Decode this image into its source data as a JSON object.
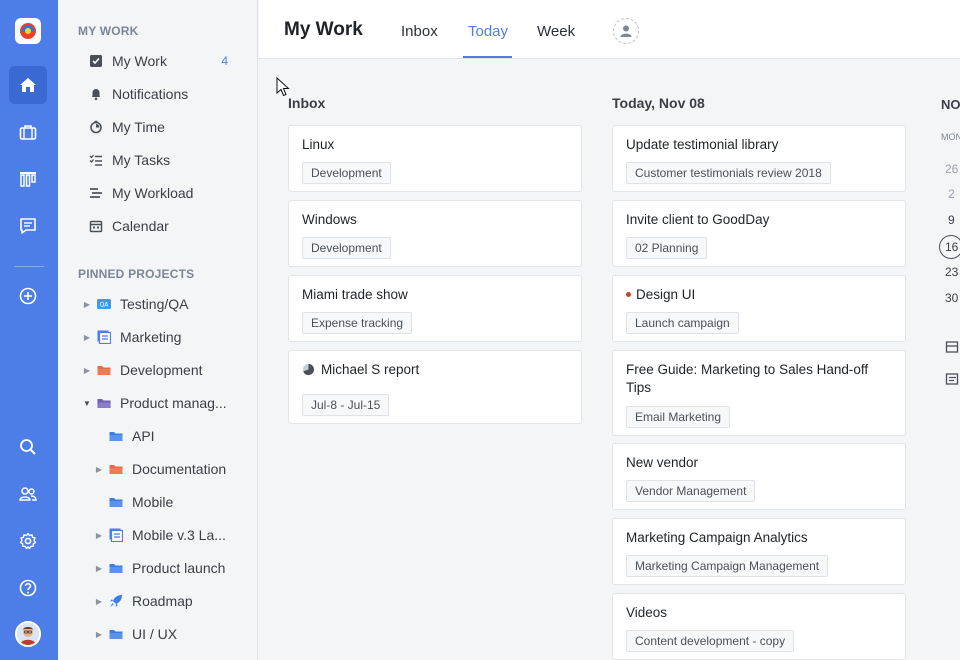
{
  "header": {
    "title": "My Work",
    "tabs": [
      {
        "label": "Inbox",
        "active": false
      },
      {
        "label": "Today",
        "active": true
      },
      {
        "label": "Week",
        "active": false
      }
    ]
  },
  "rail": {
    "icons": [
      "logo-icon",
      "home-icon",
      "briefcase-icon",
      "columns-icon",
      "chat-icon",
      "add-icon",
      "search-icon",
      "users-icon",
      "gear-icon",
      "help-icon",
      "user-avatar"
    ],
    "accent": "#4d7de6"
  },
  "sidebar": {
    "my_work_title": "MY WORK",
    "my_work_items": [
      {
        "label": "My Work",
        "icon": "check-square-icon",
        "count": "4"
      },
      {
        "label": "Notifications",
        "icon": "bell-icon"
      },
      {
        "label": "My Time",
        "icon": "timer-icon"
      },
      {
        "label": "My Tasks",
        "icon": "task-list-icon"
      },
      {
        "label": "My Workload",
        "icon": "workload-icon"
      },
      {
        "label": "Calendar",
        "icon": "calendar-icon"
      }
    ],
    "pinned_title": "PINNED PROJECTS",
    "pinned_items": [
      {
        "label": "Testing/QA",
        "icon": "qa-badge-icon",
        "badge": "QA",
        "caret": "right",
        "level": 0
      },
      {
        "label": "Marketing",
        "icon": "board-icon",
        "caret": "right",
        "level": 0
      },
      {
        "label": "Development",
        "icon": "folder-icon",
        "caret": "right",
        "level": 0
      },
      {
        "label": "Product manag...",
        "icon": "folder-icon",
        "caret": "down",
        "level": 0
      },
      {
        "label": "API",
        "icon": "folder-icon",
        "caret": "none",
        "level": 1
      },
      {
        "label": "Documentation",
        "icon": "folder-icon",
        "caret": "right",
        "level": 1
      },
      {
        "label": "Mobile",
        "icon": "folder-icon",
        "caret": "none",
        "level": 1
      },
      {
        "label": "Mobile v.3 La...",
        "icon": "board-icon",
        "caret": "right",
        "level": 1
      },
      {
        "label": "Product launch",
        "icon": "folder-icon",
        "caret": "right",
        "level": 1
      },
      {
        "label": "Roadmap",
        "icon": "rocket-icon",
        "caret": "right",
        "level": 1
      },
      {
        "label": "UI / UX",
        "icon": "folder-icon",
        "caret": "right",
        "level": 1
      }
    ]
  },
  "inbox": {
    "title": "Inbox",
    "cards": [
      {
        "title": "Linux",
        "tag": "Development"
      },
      {
        "title": "Windows",
        "tag": "Development"
      },
      {
        "title": "Miami trade show",
        "tag": "Expense tracking"
      },
      {
        "title": "Michael S report",
        "tag": "Jul-8 - Jul-15",
        "icon": "pie-icon"
      }
    ]
  },
  "today": {
    "title": "Today, Nov 08",
    "cards": [
      {
        "title": "Update testimonial library",
        "tag": "Customer testimonials review 2018"
      },
      {
        "title": "Invite client to GoodDay",
        "tag": "02 Planning"
      },
      {
        "title": "Design UI",
        "tag": "Launch campaign",
        "dot_color": "#d0441c"
      },
      {
        "title": "Free Guide: Marketing to Sales Hand-off Tips",
        "tag": "Email Marketing"
      },
      {
        "title": "New vendor",
        "tag": "Vendor Management"
      },
      {
        "title": "Marketing Campaign Analytics",
        "tag": "Marketing Campaign Management"
      },
      {
        "title": "Videos",
        "tag": "Content development - copy"
      }
    ]
  },
  "calendar": {
    "title": "NO",
    "dow": "MON",
    "days": [
      {
        "label": "26",
        "muted": true
      },
      {
        "label": "2",
        "muted": true
      },
      {
        "label": "9",
        "muted": false
      },
      {
        "label": "16",
        "muted": false,
        "today": true
      },
      {
        "label": "23",
        "muted": false
      },
      {
        "label": "30",
        "muted": false
      }
    ]
  }
}
